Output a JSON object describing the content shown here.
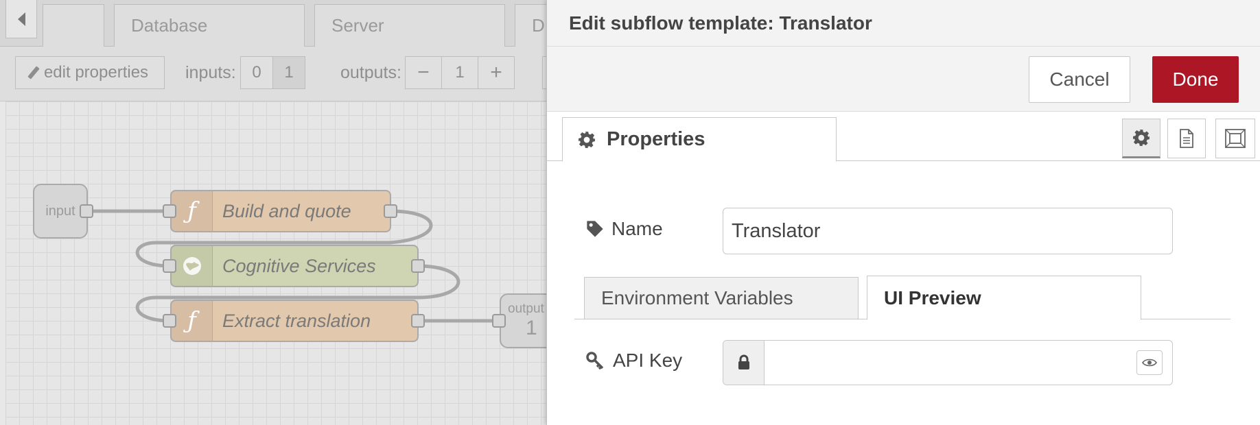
{
  "workspace": {
    "tabs": [
      "",
      "Database",
      "Server",
      "D"
    ],
    "toolbar": {
      "edit_properties": "edit properties",
      "inputs_label": "inputs:",
      "inputs_options": [
        "0",
        "1"
      ],
      "outputs_label": "outputs:",
      "outputs_minus": "−",
      "outputs_value": "1",
      "outputs_plus": "+"
    },
    "nodes": {
      "input_label": "input",
      "build_quote": "Build and quote",
      "cognitive": "Cognitive Services",
      "extract": "Extract translation",
      "output_label": "output",
      "output_number": "1",
      "function_glyph": "ƒ"
    },
    "colors": {
      "function_node": "#e2c8ac",
      "cognitive_node": "#cfd4b2"
    }
  },
  "panel": {
    "title": "Edit subflow template: Translator",
    "cancel_label": "Cancel",
    "done_label": "Done",
    "properties_tab": "Properties",
    "name_label": "Name",
    "name_value": "Translator",
    "subtabs": {
      "env": "Environment Variables",
      "ui": "UI Preview"
    },
    "apikey_label": "API Key",
    "apikey_value": "",
    "colors": {
      "done": "#ad1625"
    }
  }
}
